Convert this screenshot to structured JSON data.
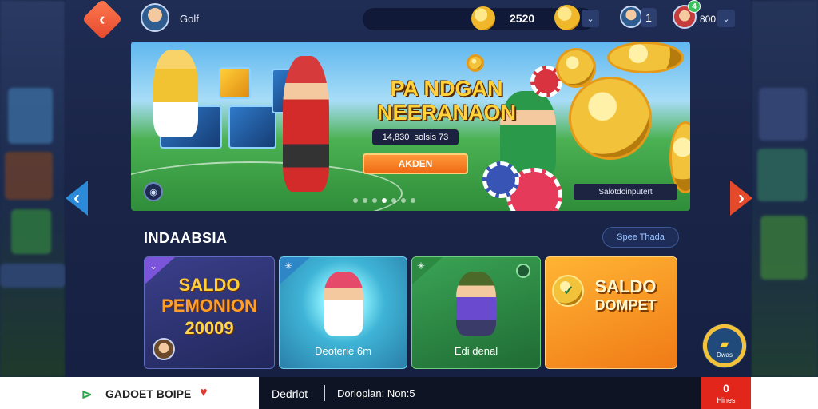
{
  "topbar": {
    "username": "Golf",
    "coins": "2520",
    "notification_count": "1",
    "level_badge": "4",
    "score": "800"
  },
  "hero": {
    "title_line1": "PA NDGAN",
    "title_line2": "NEERANAON",
    "subtitle": "14,830  solsis 73",
    "button_label": "AKDEN",
    "caption": "Salotdoinputert",
    "slide_count": 7,
    "active_slide": 3
  },
  "section": {
    "title": "INDAABSIA",
    "link_label": "Spee Thada"
  },
  "cards": [
    {
      "line1": "SALDO",
      "line2": "PEMONION",
      "line3": "20009",
      "label": ""
    },
    {
      "label": "Deoterie 6m"
    },
    {
      "label": "Edi denal"
    },
    {
      "line1": "SALDO",
      "line2": "DOMPET",
      "label": ""
    }
  ],
  "fab": {
    "label": "Dwas"
  },
  "bottombar": {
    "brand": "GADOET BOIPE",
    "text1": "Dedrlot",
    "text2": "Dorioplan: Non:5",
    "red_icon": "0",
    "red_label": "Hines"
  },
  "colors": {
    "accent_orange": "#f06b16",
    "accent_blue": "#2b8bd8",
    "accent_red": "#e3261b",
    "gold": "#ffd23a",
    "panel_bg": "#1a2547"
  },
  "icons": {
    "back": "back-arrow-icon",
    "coin": "coin-icon",
    "chevron": "chevron-down-icon",
    "left": "carousel-left-icon",
    "right": "carousel-right-icon"
  }
}
